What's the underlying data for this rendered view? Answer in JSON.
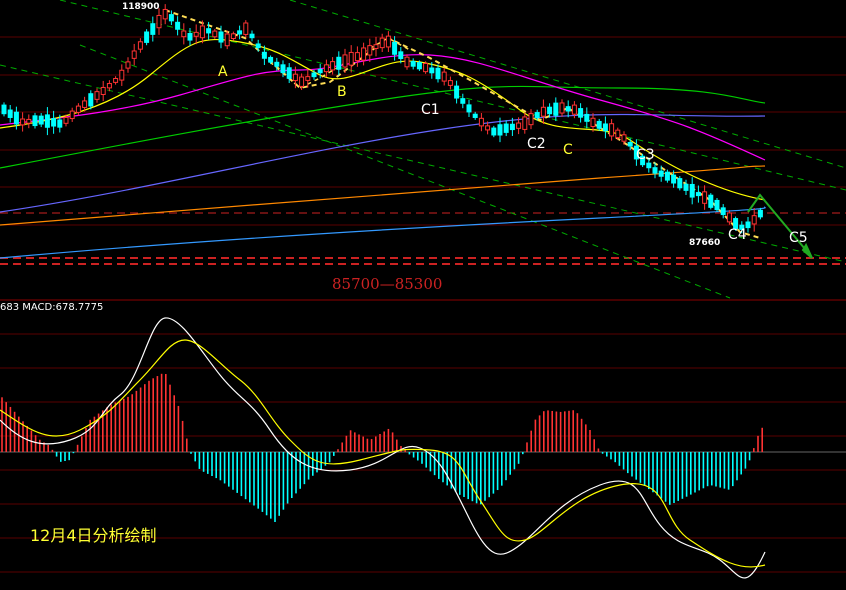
{
  "chart_data": {
    "type": "candlestick",
    "title": "",
    "macd_label": "683 MACD:678.7775",
    "target_zone_label": "85700—85300",
    "date_note": "12月4日分析绘制",
    "price_labels": [
      {
        "id": "high",
        "text": "118900",
        "value": 118900
      },
      {
        "id": "low",
        "text": "87660",
        "value": 87660
      }
    ],
    "wave_labels": [
      {
        "id": "A",
        "text": "A",
        "color": "#ffff33"
      },
      {
        "id": "B",
        "text": "B",
        "color": "#ffff33"
      },
      {
        "id": "C1",
        "text": "C1",
        "color": "#ffffff"
      },
      {
        "id": "C2",
        "text": "C2",
        "color": "#ffffff"
      },
      {
        "id": "C",
        "text": "C",
        "color": "#ffff33"
      },
      {
        "id": "C3",
        "text": "C3",
        "color": "#ffffff"
      },
      {
        "id": "C4",
        "text": "C4",
        "color": "#ffffff"
      },
      {
        "id": "C5",
        "text": "C5",
        "color": "#ffffff"
      }
    ],
    "colors": {
      "up": "#ff3333",
      "down": "#00ffff",
      "ma_short": "#ffffff",
      "ma_mid": "#ffff00",
      "ma_60": "#ff00ff",
      "ma_120": "#00cc00",
      "ma_250": "#6666ff",
      "ma_orange": "#ff8800",
      "ma_blue": "#3399ff",
      "channel": "#00aa00",
      "wave_path": "#ffdd55",
      "target_zone": "#cc2222",
      "macd_dif": "#ffffff",
      "macd_dea": "#ffff00"
    }
  }
}
